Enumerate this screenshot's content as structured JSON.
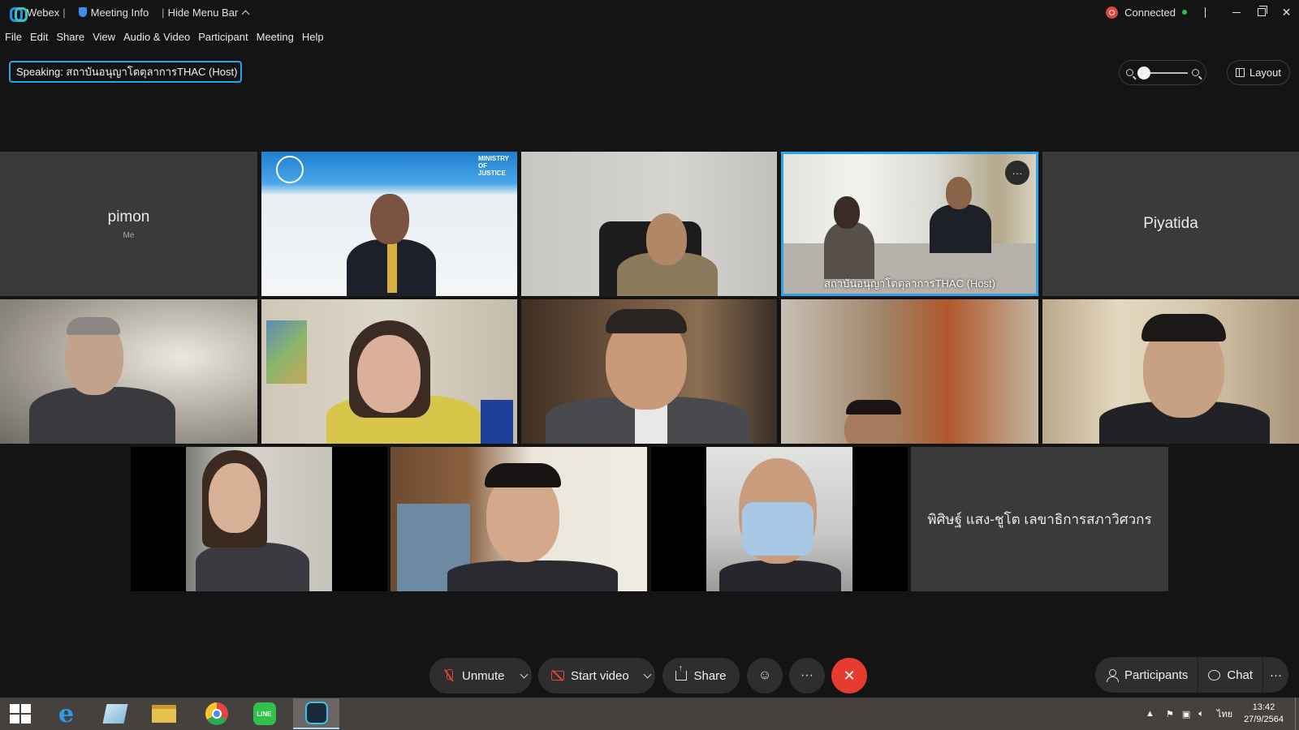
{
  "titlebar": {
    "app_name": "Webex",
    "meeting_info": "Meeting Info",
    "hide_menu": "Hide Menu Bar",
    "status": "Connected"
  },
  "menu": [
    "File",
    "Edit",
    "Share",
    "View",
    "Audio & Video",
    "Participant",
    "Meeting",
    "Help"
  ],
  "speaking": "Speaking: สถาบันอนุญาโตตุลาการTHAC (Host)",
  "layout_label": "Layout",
  "tiles": {
    "pimon": {
      "name": "pimon",
      "sub": "Me"
    },
    "piyatida": {
      "name": "Piyatida"
    },
    "host": {
      "name": "สถาบันอนุญาโตตุลาการTHAC  (Host)"
    },
    "secretary": {
      "name": "พิศิษฐ์ แสง-ชูโต เลขาธิการสภาวิศวกร"
    },
    "moj_banner": "MINISTRY OF JUSTICE"
  },
  "controls": {
    "unmute": "Unmute",
    "start_video": "Start video",
    "share": "Share",
    "participants": "Participants",
    "chat": "Chat"
  },
  "taskbar": {
    "lang": "ไทย",
    "time": "13:42",
    "date": "27/9/2564"
  }
}
